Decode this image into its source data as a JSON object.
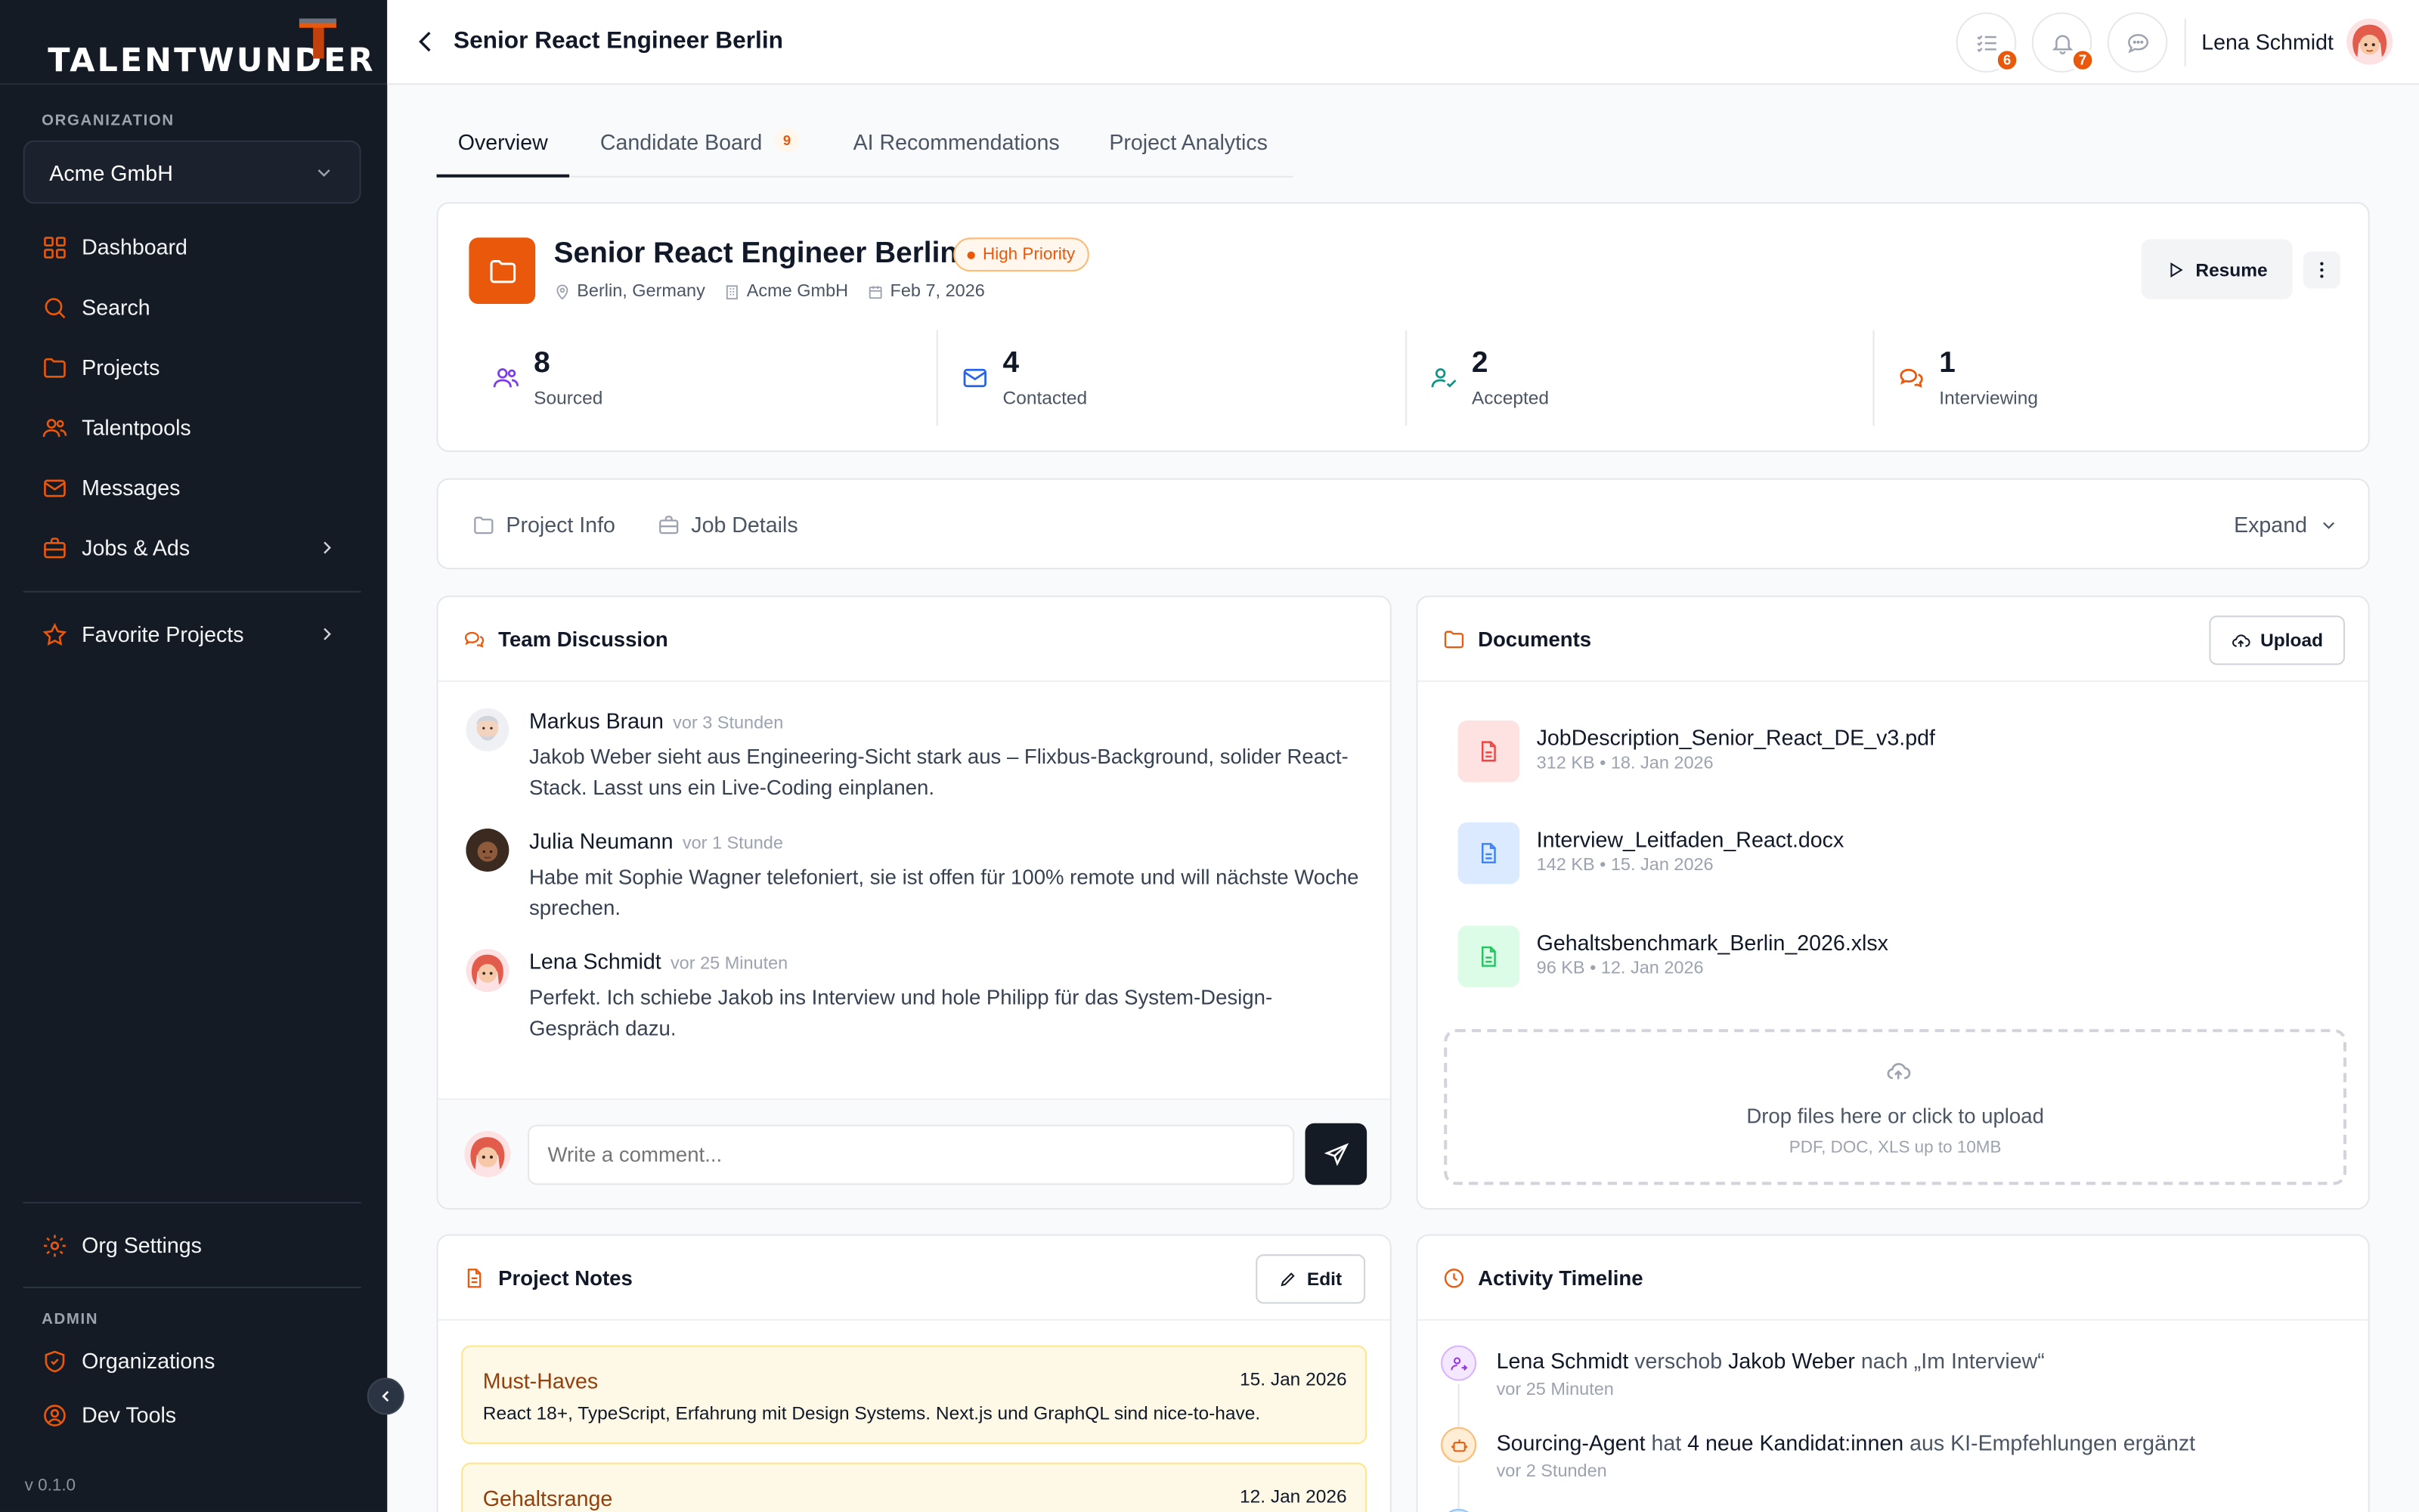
{
  "brand": {
    "name": "TALENTWUNDER",
    "accent": "#ea580c",
    "sidebar_bg": "#151b24"
  },
  "sidebar": {
    "org_label": "ORGANIZATION",
    "org_value": "Acme GmbH",
    "nav": [
      {
        "label": "Dashboard",
        "icon": "grid-icon"
      },
      {
        "label": "Search",
        "icon": "search-icon"
      },
      {
        "label": "Projects",
        "icon": "folder-icon"
      },
      {
        "label": "Talentpools",
        "icon": "users-icon"
      },
      {
        "label": "Messages",
        "icon": "mail-icon"
      },
      {
        "label": "Jobs & Ads",
        "icon": "briefcase-icon"
      }
    ],
    "favorites_label": "Favorite Projects",
    "settings_label": "Org Settings",
    "admin_label": "ADMIN",
    "admin_items": [
      {
        "label": "Organizations",
        "icon": "shield-icon"
      },
      {
        "label": "Dev Tools",
        "icon": "user-circle-icon"
      }
    ],
    "version": "v 0.1.0"
  },
  "topbar": {
    "title": "Senior React Engineer Berlin",
    "tasks_count": "6",
    "notifications_count": "7",
    "user_name": "Lena Schmidt"
  },
  "tabs": [
    {
      "label": "Overview",
      "active": true
    },
    {
      "label": "Candidate Board",
      "badge": "9"
    },
    {
      "label": "AI Recommendations"
    },
    {
      "label": "Project Analytics"
    }
  ],
  "project": {
    "title": "Senior React Engineer Berlin",
    "priority": "High Priority",
    "location": "Berlin, Germany",
    "company": "Acme GmbH",
    "date": "Feb 7, 2026",
    "resume_label": "Resume",
    "stats": [
      {
        "value": "8",
        "label": "Sourced",
        "color": "#7c3aed"
      },
      {
        "value": "4",
        "label": "Contacted",
        "color": "#2563eb"
      },
      {
        "value": "2",
        "label": "Accepted",
        "color": "#0d9488"
      },
      {
        "value": "1",
        "label": "Interviewing",
        "color": "#ea580c"
      }
    ]
  },
  "subtabs": {
    "info": "Project Info",
    "job": "Job Details",
    "expand": "Expand"
  },
  "discussion": {
    "title": "Team Discussion",
    "messages": [
      {
        "name": "Markus Braun",
        "time": "vor 3 Stunden",
        "text": "Jakob Weber sieht aus Engineering-Sicht stark aus – Flixbus-Background, solider React-Stack. Lasst uns ein Live-Coding einplanen."
      },
      {
        "name": "Julia Neumann",
        "time": "vor 1 Stunde",
        "text": "Habe mit Sophie Wagner telefoniert, sie ist offen für 100% remote und will nächste Woche sprechen."
      },
      {
        "name": "Lena Schmidt",
        "time": "vor 25 Minuten",
        "text": "Perfekt. Ich schiebe Jakob ins Interview und hole Philipp für das System-Design-Gespräch dazu."
      }
    ],
    "placeholder": "Write a comment..."
  },
  "documents": {
    "title": "Documents",
    "upload_label": "Upload",
    "files": [
      {
        "name": "JobDescription_Senior_React_DE_v3.pdf",
        "meta": "312 KB • 18. Jan 2026"
      },
      {
        "name": "Interview_Leitfaden_React.docx",
        "meta": "142 KB • 15. Jan 2026"
      },
      {
        "name": "Gehaltsbenchmark_Berlin_2026.xlsx",
        "meta": "96 KB • 12. Jan 2026"
      }
    ],
    "drop_text": "Drop files here or click to upload",
    "drop_hint": "PDF, DOC, XLS up to 10MB"
  },
  "notes": {
    "title": "Project Notes",
    "edit_label": "Edit",
    "items": [
      {
        "title": "Must-Haves",
        "date": "15. Jan 2026",
        "text": "React 18+, TypeScript, Erfahrung mit Design Systems. Next.js und GraphQL sind nice-to-have."
      },
      {
        "title": "Gehaltsrange",
        "date": "12. Jan 2026"
      }
    ]
  },
  "timeline": {
    "title": "Activity Timeline",
    "items": [
      {
        "actor": "Lena Schmidt",
        "verb": "verschob",
        "object": "Jakob Weber",
        "rest": "nach „Im Interview“",
        "time": "vor 25 Minuten"
      },
      {
        "actor": "Sourcing-Agent",
        "verb": "hat",
        "object": "4 neue Kandidat:innen",
        "rest": "aus KI-Empfehlungen ergänzt",
        "time": "vor 2 Stunden"
      }
    ]
  }
}
